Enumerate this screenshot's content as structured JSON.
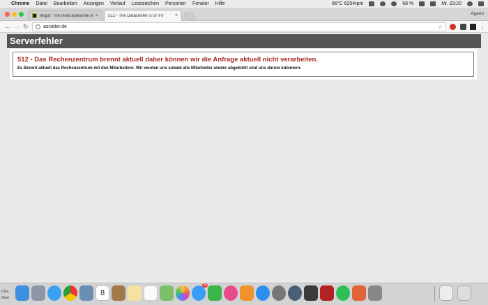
{
  "menubar": {
    "app_name": "Chrome",
    "items": [
      "Datei",
      "Bearbeiten",
      "Anzeigen",
      "Verlauf",
      "Lesezeichen",
      "Personen",
      "Fenster",
      "Hilfe"
    ],
    "status_text": "86°C 6204rpm",
    "battery": "68 %",
    "clock": "Mi. 23:20"
  },
  "tabs": [
    {
      "title": "Imgur: The most awesome ima",
      "favicon": "imgur-icon"
    },
    {
      "title": "512 - The Datacenter is on Fir",
      "favicon": "page-icon"
    }
  ],
  "profile_name": "Agario",
  "address_bar": {
    "url": "ascalter.de"
  },
  "page": {
    "header_title": "Serverfehler",
    "error_title": "512 - Das Rechenzentrum brennt aktuell daher können wir die Anfrage aktuell nicht verarbeiten.",
    "error_text": "Es Brennt aktuell das Rechenzentrum mit den Mitarbeitern. Wir werden uns sobald alle Mitarbeiter wieder abgekühlt sind uns darum kümmern."
  },
  "dock": {
    "left_labels": [
      "Cha",
      "New"
    ],
    "calendar_day": "8",
    "messages_badge": "20",
    "icons": [
      "finder-icon",
      "launchpad-icon",
      "safari-icon",
      "chrome-icon",
      "preview-icon",
      "calendar-icon",
      "contacts-icon",
      "notes-icon",
      "reminders-icon",
      "maps-icon",
      "photos-icon",
      "messages-icon",
      "facetime-icon",
      "itunes-icon",
      "ibooks-icon",
      "appstore-icon",
      "system-preferences-icon",
      "quicktime-icon",
      "sublime-icon",
      "filezilla-icon",
      "whatsapp-icon",
      "feed-icon",
      "textedit-icon",
      "downloads-icon",
      "trash-icon"
    ]
  },
  "colors": {
    "header_bg": "#555555",
    "error_title": "#a52a1f",
    "page_bg": "#e9e9e9"
  }
}
